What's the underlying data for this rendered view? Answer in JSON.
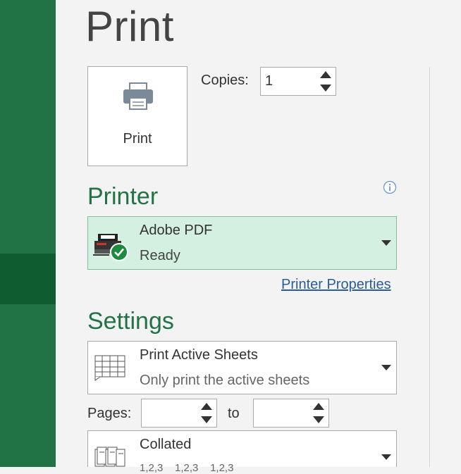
{
  "title": "Print",
  "print_button": {
    "label": "Print",
    "icon": "printer-icon"
  },
  "copies": {
    "label": "Copies:",
    "value": "1"
  },
  "printer_section": {
    "title": "Printer",
    "selected_printer": {
      "name": "Adobe PDF",
      "status": "Ready"
    },
    "properties_link": "Printer Properties"
  },
  "settings_section": {
    "title": "Settings",
    "print_what": {
      "main": "Print Active Sheets",
      "sub": "Only print the active sheets"
    },
    "pages": {
      "label": "Pages:",
      "to_label": "to",
      "from_value": "",
      "to_value": ""
    },
    "collation": {
      "main": "Collated",
      "sub": "1,2,3    1,2,3    1,2,3"
    }
  },
  "colors": {
    "accent": "#217346",
    "selected_bg": "#d3f0e0",
    "link": "#2a5c9a"
  }
}
